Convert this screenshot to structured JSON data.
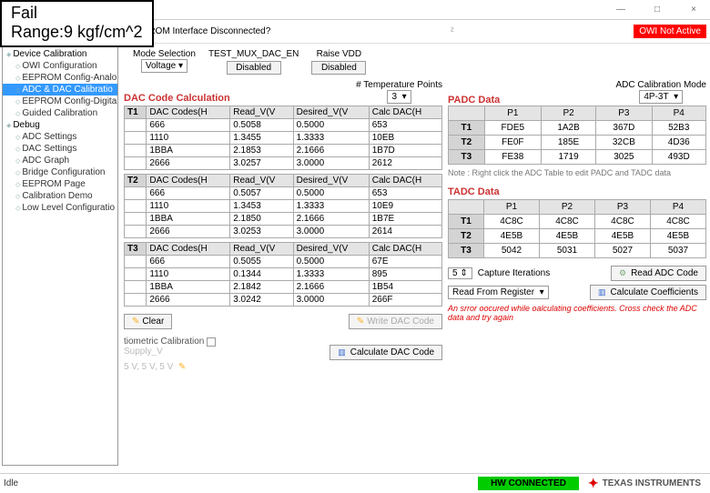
{
  "overlay": {
    "line1": "Fail",
    "line2": "Range:9 kgf/cm^2"
  },
  "window": {
    "min": "—",
    "max": "□",
    "close": "×"
  },
  "titlebar": {
    "msg": "EPROM Interface Disconnected?",
    "zoom": "ᶻ",
    "owi": "OWI Not Active"
  },
  "tree": {
    "roots": [
      {
        "label": "Device Calibration",
        "children": [
          {
            "label": "OWI Configuration"
          },
          {
            "label": "EEPROM Config-Analo"
          },
          {
            "label": "ADC & DAC Calibratio",
            "sel": true
          },
          {
            "label": "EEPROM Config-Digita"
          },
          {
            "label": "Guided Calibration"
          }
        ]
      },
      {
        "label": "Debug",
        "children": [
          {
            "label": "ADC Settings"
          },
          {
            "label": "DAC Settings"
          },
          {
            "label": "ADC Graph"
          },
          {
            "label": "Bridge Configuration"
          },
          {
            "label": "EEPROM Page"
          },
          {
            "label": "Calibration Demo"
          },
          {
            "label": "Low Level Configuratio"
          }
        ]
      }
    ]
  },
  "top": {
    "mode_lbl": "Mode Selection",
    "mode_val": "Voltage",
    "mux_lbl": "TEST_MUX_DAC_EN",
    "mux_val": "Disabled",
    "raise_lbl": "Raise VDD",
    "raise_val": "Disabled"
  },
  "dac_section": {
    "title": "DAC Code Calculation",
    "temp_lbl": "# Temperature Points",
    "temp_val": "3",
    "cols": [
      "DAC Codes(H",
      "Read_V(V",
      "Desired_V(V",
      "Calc DAC(H"
    ],
    "t1": {
      "hdr": "T1",
      "rows": [
        [
          "666",
          "0.5058",
          "0.5000",
          "653"
        ],
        [
          "1110",
          "1.3455",
          "1.3333",
          "10EB"
        ],
        [
          "1BBA",
          "2.1853",
          "2.1666",
          "1B7D"
        ],
        [
          "2666",
          "3.0257",
          "3.0000",
          "2612"
        ]
      ]
    },
    "t2": {
      "hdr": "T2",
      "rows": [
        [
          "666",
          "0.5057",
          "0.5000",
          "653"
        ],
        [
          "1110",
          "1.3453",
          "1.3333",
          "10E9"
        ],
        [
          "1BBA",
          "2.1850",
          "2.1666",
          "1B7E"
        ],
        [
          "2666",
          "3.0253",
          "3.0000",
          "2614"
        ]
      ]
    },
    "t3": {
      "hdr": "T3",
      "rows": [
        [
          "666",
          "0.5055",
          "0.5000",
          "67E"
        ],
        [
          "1110",
          "0.1344",
          "1.3333",
          "895"
        ],
        [
          "1BBA",
          "2.1842",
          "2.1666",
          "1B54"
        ],
        [
          "2666",
          "3.0242",
          "3.0000",
          "266F"
        ]
      ]
    },
    "clear": "Clear",
    "write": "Write DAC Code",
    "calc": "Calculate DAC Code",
    "ratio_lbl": "tiometric Calibration",
    "supply_lbl": "Supply_V",
    "supply_val": "5 V, 5 V, 5 V"
  },
  "adc_section": {
    "mode_lbl": "ADC Calibration Mode",
    "mode_val": "4P-3T",
    "padc_title": "PADC Data",
    "cols": [
      "P1",
      "P2",
      "P3",
      "P4"
    ],
    "padc": [
      {
        "r": "T1",
        "v": [
          "FDE5",
          "1A2B",
          "367D",
          "52B3"
        ]
      },
      {
        "r": "T2",
        "v": [
          "FE0F",
          "185E",
          "32CB",
          "4D36"
        ]
      },
      {
        "r": "T3",
        "v": [
          "FE38",
          "1719",
          "3025",
          "493D"
        ]
      }
    ],
    "note": "Note : Right click the ADC Table to edit PADC and TADC data",
    "tadc_title": "TADC Data",
    "tadc": [
      {
        "r": "T1",
        "v": [
          "4C8C",
          "4C8C",
          "4C8C",
          "4C8C"
        ]
      },
      {
        "r": "T2",
        "v": [
          "4E5B",
          "4E5B",
          "4E5B",
          "4E5B"
        ]
      },
      {
        "r": "T3",
        "v": [
          "5042",
          "5031",
          "5027",
          "5037"
        ]
      }
    ],
    "cap_val": "5",
    "cap_lbl": "Capture Iterations",
    "read_btn": "Read ADC Code",
    "readreg": "Read From Register",
    "calc_coef": "Calculate Coefficients",
    "err": "An srror oocured while oalculating coefficients. Cross check the ADC data and try again"
  },
  "footer": {
    "idle": "Idle",
    "hw": "HW CONNECTED",
    "ti": "TEXAS INSTRUMENTS"
  }
}
